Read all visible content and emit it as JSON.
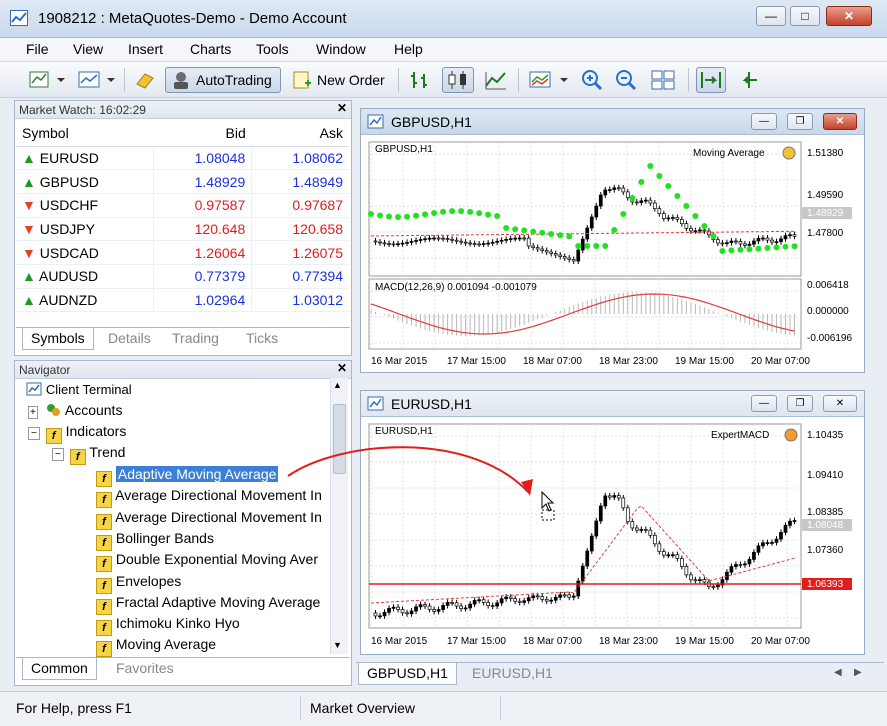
{
  "window": {
    "title": "1908212 : MetaQuotes-Demo - Demo Account"
  },
  "menu": [
    "File",
    "View",
    "Insert",
    "Charts",
    "Tools",
    "Window",
    "Help"
  ],
  "toolbar": {
    "autotrading": "AutoTrading",
    "new_order": "New Order"
  },
  "market_watch": {
    "title": "Market Watch: 16:02:29",
    "columns": [
      "Symbol",
      "Bid",
      "Ask"
    ],
    "rows": [
      {
        "symbol": "EURUSD",
        "bid": "1.08048",
        "ask": "1.08062",
        "dir": "up"
      },
      {
        "symbol": "GBPUSD",
        "bid": "1.48929",
        "ask": "1.48949",
        "dir": "up"
      },
      {
        "symbol": "USDCHF",
        "bid": "0.97587",
        "ask": "0.97687",
        "dir": "down"
      },
      {
        "symbol": "USDJPY",
        "bid": "120.648",
        "ask": "120.658",
        "dir": "down"
      },
      {
        "symbol": "USDCAD",
        "bid": "1.26064",
        "ask": "1.26075",
        "dir": "down"
      },
      {
        "symbol": "AUDUSD",
        "bid": "0.77379",
        "ask": "0.77394",
        "dir": "up"
      },
      {
        "symbol": "AUDNZD",
        "bid": "1.02964",
        "ask": "1.03012",
        "dir": "up"
      }
    ],
    "tabs": [
      "Symbols",
      "Details",
      "Trading",
      "Ticks"
    ]
  },
  "navigator": {
    "title": "Navigator",
    "root": "Client Terminal",
    "accounts": "Accounts",
    "indicators": "Indicators",
    "trend": "Trend",
    "items": [
      "Adaptive Moving Average",
      "Average Directional Movement In",
      "Average Directional Movement In",
      "Bollinger Bands",
      "Double Exponential Moving Aver",
      "Envelopes",
      "Fractal Adaptive Moving Average",
      "Ichimoku Kinko Hyo",
      "Moving Average"
    ],
    "tabs": [
      "Common",
      "Favorites"
    ]
  },
  "chart1": {
    "window_title": "GBPUSD,H1",
    "symbol_label": "GBPUSD,H1",
    "expert": "Moving Average",
    "price_labels": [
      "1.51380",
      "1.49590",
      "1.48929",
      "1.47800"
    ],
    "macd_label": "MACD(12,26,9) 0.001094 -0.001079",
    "macd_labels": [
      "0.006418",
      "0.000000",
      "-0.006196"
    ],
    "time_labels": [
      "16 Mar 2015",
      "17 Mar 15:00",
      "18 Mar 07:00",
      "18 Mar 23:00",
      "19 Mar 15:00",
      "20 Mar 07:00"
    ]
  },
  "chart2": {
    "window_title": "EURUSD,H1",
    "symbol_label": "EURUSD,H1",
    "expert": "ExpertMACD",
    "price_labels": [
      "1.10435",
      "1.09410",
      "1.08385",
      "1.08048",
      "1.07360",
      "1.06393"
    ],
    "time_labels": [
      "16 Mar 2015",
      "17 Mar 15:00",
      "18 Mar 07:00",
      "18 Mar 23:00",
      "19 Mar 15:00",
      "20 Mar 07:00"
    ]
  },
  "chart_tabs": [
    "GBPUSD,H1",
    "EURUSD,H1"
  ],
  "status": {
    "help": "For Help, press F1",
    "overview": "Market Overview"
  },
  "colors": {
    "accent": "#3b7fd6",
    "up": "#1c9b1c",
    "down": "#e3411c",
    "bid_blue": "#1a2fe0",
    "bid_red": "#e31c1c",
    "sar_green": "#22e022",
    "ma_red": "#e33c3c",
    "level_red": "#e31c1c"
  }
}
